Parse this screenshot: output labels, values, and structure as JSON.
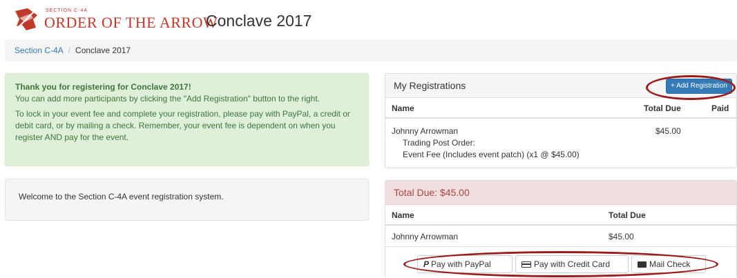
{
  "header": {
    "section_small": "SECTION C-4A",
    "org_title": "ORDER OF THE ARROW",
    "event_title": "Conclave 2017"
  },
  "breadcrumb": {
    "items": [
      "Section C-4A",
      "Conclave 2017"
    ],
    "separator": "/"
  },
  "alert": {
    "heading": "Thank you for registering for Conclave 2017!",
    "line1": "You can add more participants by clicking the \"Add Registration\" button to the right.",
    "line2": "To lock in your event fee and complete your registration, please pay with PayPal, a credit or debit card, or by mailing a check. Remember, your event fee is dependent on when you register AND pay for the event."
  },
  "welcome": {
    "text": "Welcome to the Section C-4A event registration system."
  },
  "registrations": {
    "title": "My Registrations",
    "add_button": "+ Add Registration",
    "columns": [
      "Name",
      "Total Due",
      "Paid"
    ],
    "rows": [
      {
        "name": "Johnny Arrowman",
        "total_due": "$45.00",
        "detail1": "Trading Post Order:",
        "detail2": "Event Fee (Includes event patch) (x1 @ $45.00)"
      }
    ]
  },
  "total": {
    "title": "Total Due: $45.00",
    "columns": [
      "Name",
      "Total Due"
    ],
    "rows": [
      {
        "name": "Johnny Arrowman",
        "total_due": "$45.00"
      }
    ]
  },
  "payment": {
    "paypal": "Pay with PayPal",
    "credit": "Pay with Credit Card",
    "check": "Mail Check"
  },
  "colors": {
    "brand_red": "#c0392b",
    "link_blue": "#337ab7",
    "success_bg": "#dff0d8",
    "danger_bg": "#f2dede",
    "annotation_oval": "#9b1c1c"
  }
}
